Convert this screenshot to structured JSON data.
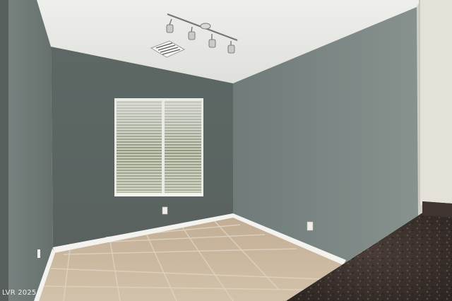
{
  "photo": {
    "watermark": "LVR 2025",
    "colors": {
      "wall_left": "#6d7774",
      "wall_back": "#5b6663",
      "wall_right": "#7e8a88",
      "ceiling": "#e9e9e6",
      "floor": "#c9b49a",
      "baseboard": "#f2f1ec",
      "countertop": "#3a302c"
    }
  }
}
